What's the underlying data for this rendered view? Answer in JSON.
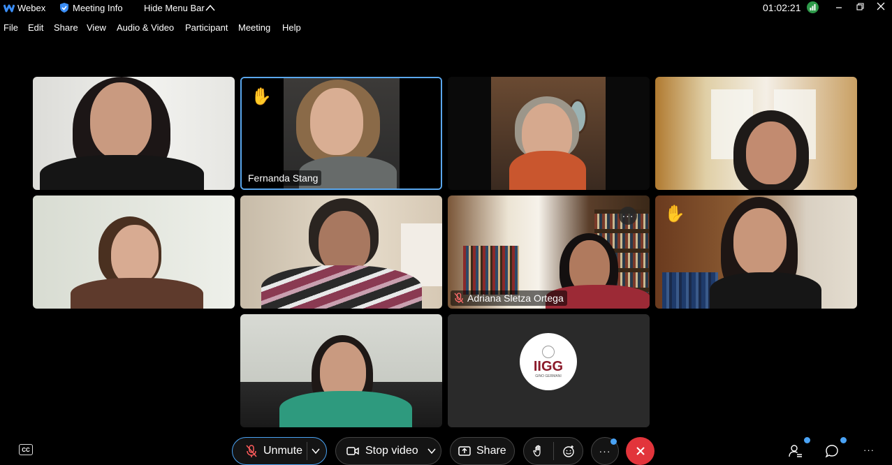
{
  "titlebar": {
    "app_name": "Webex",
    "meeting_info": "Meeting Info",
    "hide_menu_bar": "Hide Menu Bar",
    "timer": "01:02:21"
  },
  "menu": [
    "File",
    "Edit",
    "Share",
    "View",
    "Audio & Video",
    "Participant",
    "Meeting",
    "Help"
  ],
  "participants": {
    "fernanda": "Fernanda Stang",
    "adriana": "Adriana Sletza Ortega"
  },
  "logo_tile": {
    "logo_text": "IIGG",
    "logo_subtext": "GINO GERMANI"
  },
  "controls": {
    "unmute": "Unmute",
    "stop_video": "Stop video",
    "share": "Share",
    "more": "···",
    "cc": "CC"
  },
  "colors": {
    "accent": "#5aa7ee",
    "end_call": "#e2343b",
    "badge": "#4aa3f5",
    "signal": "#2e9a4a",
    "logo_red": "#8b1a2a"
  },
  "icons": {
    "raise_hand": "✋",
    "more_dots": "···"
  }
}
